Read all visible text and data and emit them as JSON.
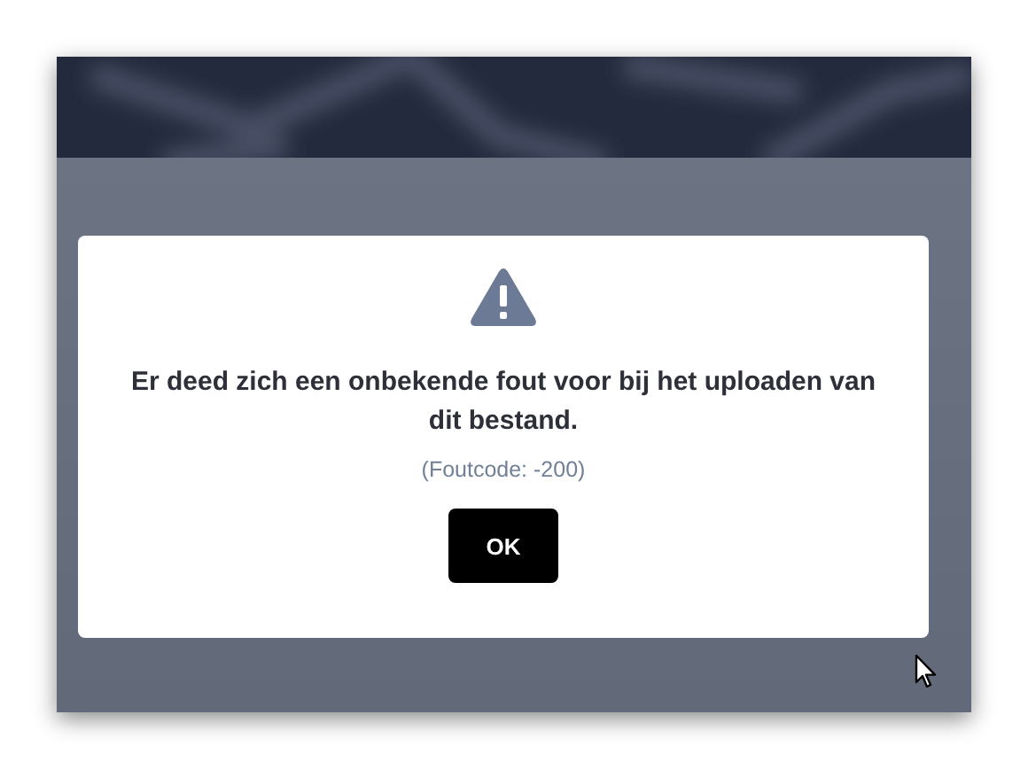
{
  "dialog": {
    "message": "Er deed zich een onbekende fout voor bij het uploaden van dit bestand.",
    "error_code": "(Foutcode: -200)",
    "buttons": [
      {
        "label": "OK"
      }
    ]
  }
}
